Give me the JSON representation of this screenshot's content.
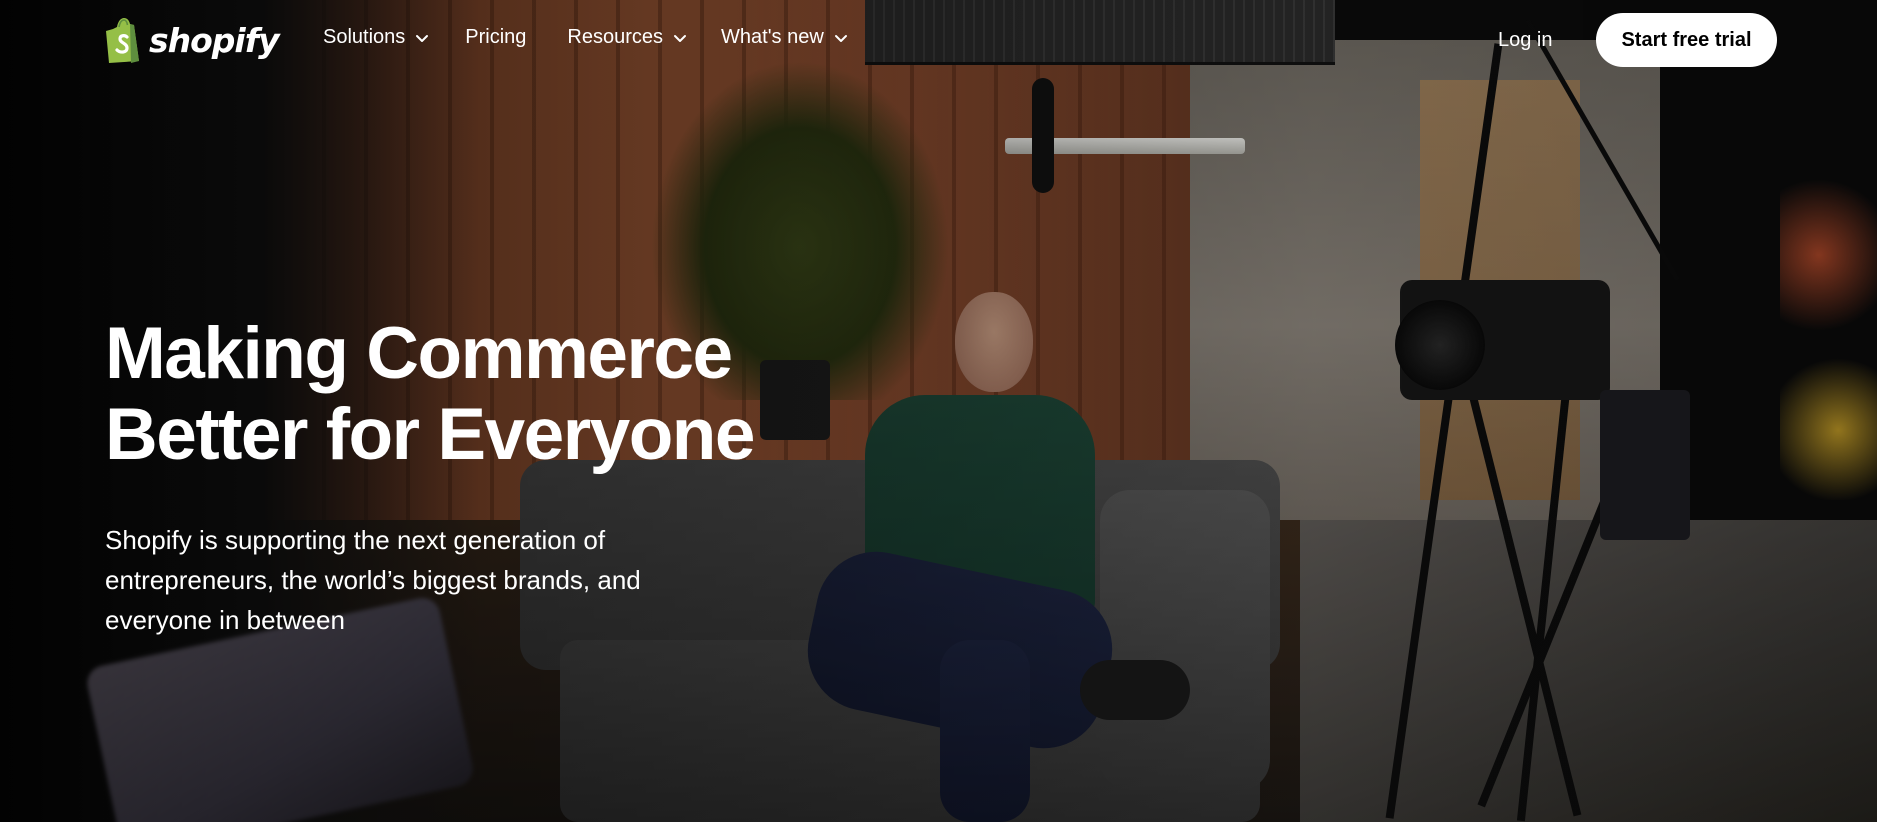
{
  "brand": {
    "name": "shopify",
    "logo_color": "#95bf47"
  },
  "nav": {
    "items": [
      {
        "label": "Solutions",
        "has_dropdown": true
      },
      {
        "label": "Pricing",
        "has_dropdown": false
      },
      {
        "label": "Resources",
        "has_dropdown": true
      },
      {
        "label": "What's new",
        "has_dropdown": true
      }
    ],
    "login_label": "Log in",
    "cta_label": "Start free trial"
  },
  "hero": {
    "title_line1": "Making Commerce",
    "title_line2": "Better for Everyone",
    "subtitle": "Shopify is supporting the next generation of entrepreneurs, the world’s biggest brands, and everyone in between"
  }
}
